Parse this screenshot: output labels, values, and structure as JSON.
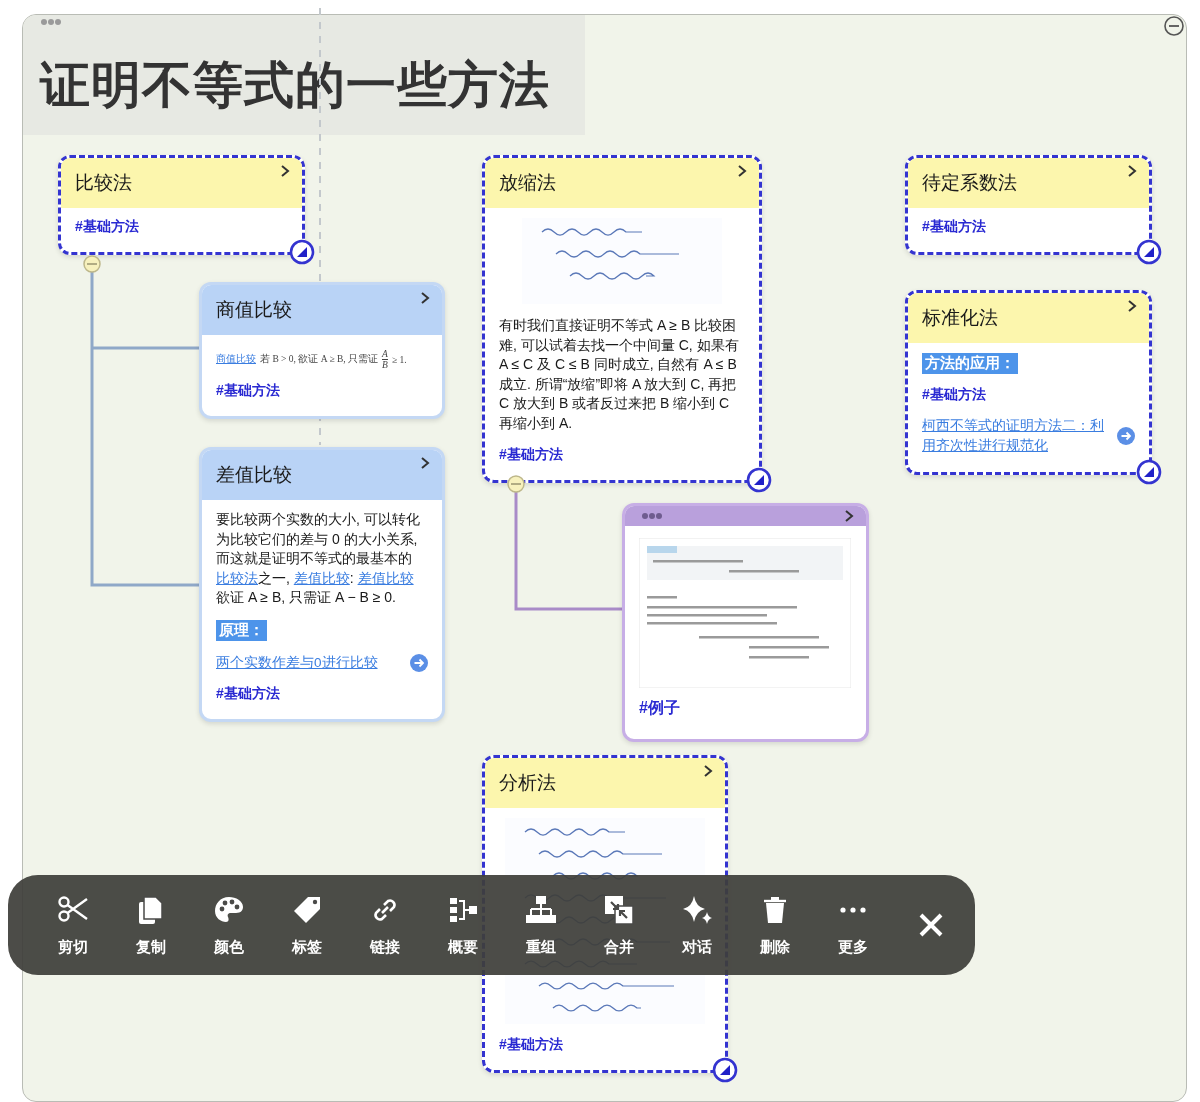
{
  "canvas": {
    "title": "证明不等式的一些方法"
  },
  "cards": [
    {
      "kind": "topic",
      "color": "#fcf6ad",
      "title": "比较法",
      "blocks": [
        {
          "kind": "tag",
          "text": "#基础方法"
        }
      ]
    },
    {
      "kind": "subtopic",
      "color": "#b9d3f6",
      "title": "商值比较",
      "blocks": [
        {
          "kind": "formula",
          "segments": [
            {
              "kind": "link",
              "text": "商值比较"
            },
            {
              "kind": "text",
              "text": "若 B > 0, 欲证 A ≥ B, 只需证"
            },
            {
              "kind": "fraction",
              "numerator": "A",
              "denominator": "B"
            },
            {
              "kind": "text",
              "text": "≥ 1."
            }
          ]
        },
        {
          "kind": "tag",
          "text": "#基础方法"
        }
      ]
    },
    {
      "kind": "subtopic",
      "color": "#b9d3f6",
      "title": "差值比较",
      "blocks": [
        {
          "kind": "paragraph",
          "segments": [
            {
              "kind": "text",
              "text": "要比较两个实数的大小, 可以转化为比较它们的差与 0 的大小关系, 而这就是证明不等式的最基本的"
            },
            {
              "kind": "link",
              "text": "比较法"
            },
            {
              "kind": "text",
              "text": "之一, "
            },
            {
              "kind": "link",
              "text": "差值比较"
            },
            {
              "kind": "text",
              "text": ": "
            },
            {
              "kind": "link",
              "text": "差值比较"
            },
            {
              "kind": "text",
              "text": " 欲证 A ≥ B, 只需证 A − B ≥ 0."
            }
          ]
        },
        {
          "kind": "highlight",
          "text": "原理："
        },
        {
          "kind": "link",
          "text": "两个实数作差与0进行比较"
        },
        {
          "kind": "tag",
          "text": "#基础方法"
        }
      ]
    },
    {
      "kind": "topic",
      "color": "#fcf6ad",
      "title": "放缩法",
      "blocks": [
        {
          "kind": "sketch"
        },
        {
          "kind": "paragraph",
          "segments": [
            {
              "kind": "text",
              "text": "有时我们直接证明不等式 A ≥ B 比较困难, 可以试着去找一个中间量 C, 如果有 A ≤ C 及 C ≤ B 同时成立, 自然有 A ≤ B 成立. 所谓“放缩”即将 A 放大到 C, 再把 C 放大到 B 或者反过来把 B 缩小到 C 再缩小到 A."
            }
          ]
        },
        {
          "kind": "tag",
          "text": "#基础方法"
        }
      ]
    },
    {
      "kind": "topic",
      "color": "#fcf6ad",
      "title": "待定系数法",
      "blocks": [
        {
          "kind": "tag",
          "text": "#基础方法"
        }
      ]
    },
    {
      "kind": "topic",
      "color": "#fcf6ad",
      "title": "标准化法",
      "blocks": [
        {
          "kind": "highlight",
          "text": "方法的应用："
        },
        {
          "kind": "tag",
          "text": "#基础方法"
        },
        {
          "kind": "link",
          "text": "柯西不等式的证明方法二：利用齐次性进行规范化"
        }
      ]
    },
    {
      "kind": "example",
      "color": "#b9a0dc",
      "blocks": [
        {
          "kind": "document"
        },
        {
          "kind": "tag",
          "text": "#例子"
        }
      ]
    },
    {
      "kind": "topic",
      "color": "#fcf6ad",
      "title": "分析法",
      "blocks": [
        {
          "kind": "sketch"
        },
        {
          "kind": "tag",
          "text": "#基础方法"
        }
      ]
    }
  ],
  "toolbar": {
    "items": [
      {
        "label": "剪切"
      },
      {
        "label": "复制"
      },
      {
        "label": "颜色"
      },
      {
        "label": "标签"
      },
      {
        "label": "链接"
      },
      {
        "label": "概要"
      },
      {
        "label": "重组"
      },
      {
        "label": "合并"
      },
      {
        "label": "对话"
      },
      {
        "label": "删除"
      },
      {
        "label": "更多"
      }
    ]
  }
}
